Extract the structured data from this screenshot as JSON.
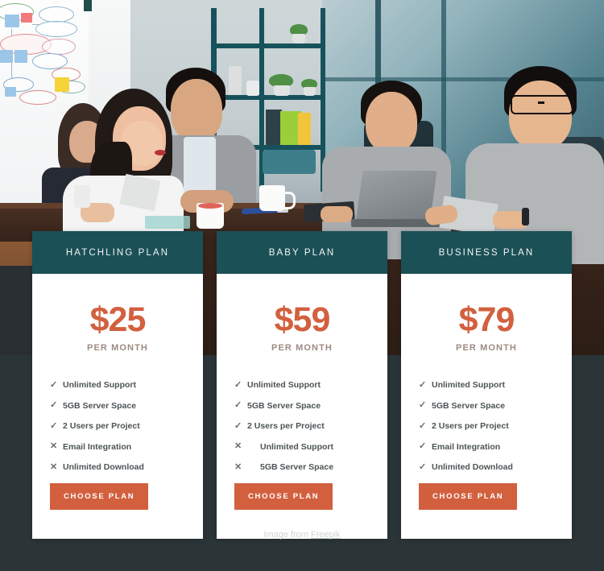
{
  "hero": {
    "alt": "team meeting in office conference room"
  },
  "plans": [
    {
      "name": "HATCHLING PLAN",
      "price": "$25",
      "period": "PER MONTH",
      "features": [
        {
          "mark": "check-icon",
          "glyph": "✓",
          "label": "Unlimited Support",
          "indented": false
        },
        {
          "mark": "check-icon",
          "glyph": "✓",
          "label": "5GB Server Space",
          "indented": false
        },
        {
          "mark": "check-icon",
          "glyph": "✓",
          "label": "2 Users per Project",
          "indented": false
        },
        {
          "mark": "cross-icon",
          "glyph": "✕",
          "label": "Email Integration",
          "indented": false
        },
        {
          "mark": "cross-icon",
          "glyph": "✕",
          "label": "Unlimited Download",
          "indented": false
        }
      ],
      "cta": "CHOOSE PLAN"
    },
    {
      "name": "BABY PLAN",
      "price": "$59",
      "period": "PER MONTH",
      "features": [
        {
          "mark": "check-icon",
          "glyph": "✓",
          "label": "Unlimited Support",
          "indented": false
        },
        {
          "mark": "check-icon",
          "glyph": "✓",
          "label": "5GB Server Space",
          "indented": false
        },
        {
          "mark": "check-icon",
          "glyph": "✓",
          "label": "2 Users per Project",
          "indented": false
        },
        {
          "mark": "cross-icon",
          "glyph": "✕",
          "label": "Unlimited Support",
          "indented": true
        },
        {
          "mark": "cross-icon",
          "glyph": "✕",
          "label": "5GB Server Space",
          "indented": true
        }
      ],
      "cta": "CHOOSE PLAN"
    },
    {
      "name": "BUSINESS PLAN",
      "price": "$79",
      "period": "PER MONTH",
      "features": [
        {
          "mark": "check-icon",
          "glyph": "✓",
          "label": "Unlimited Support",
          "indented": false
        },
        {
          "mark": "check-icon",
          "glyph": "✓",
          "label": "5GB Server Space",
          "indented": false
        },
        {
          "mark": "check-icon",
          "glyph": "✓",
          "label": "2 Users per Project",
          "indented": false
        },
        {
          "mark": "check-icon",
          "glyph": "✓",
          "label": "Email Integration",
          "indented": false
        },
        {
          "mark": "check-icon",
          "glyph": "✓",
          "label": "Unlimited Download",
          "indented": false
        }
      ],
      "cta": "CHOOSE PLAN"
    }
  ],
  "footer": {
    "prefix": "Image from ",
    "link": "Freepik"
  },
  "colors": {
    "header_teal": "#1b5057",
    "accent_orange": "#d2603f",
    "page_background": "#2b3538",
    "card_background": "#ffffff",
    "feature_text": "#4d5356",
    "per_month_text": "#9d8a82"
  }
}
